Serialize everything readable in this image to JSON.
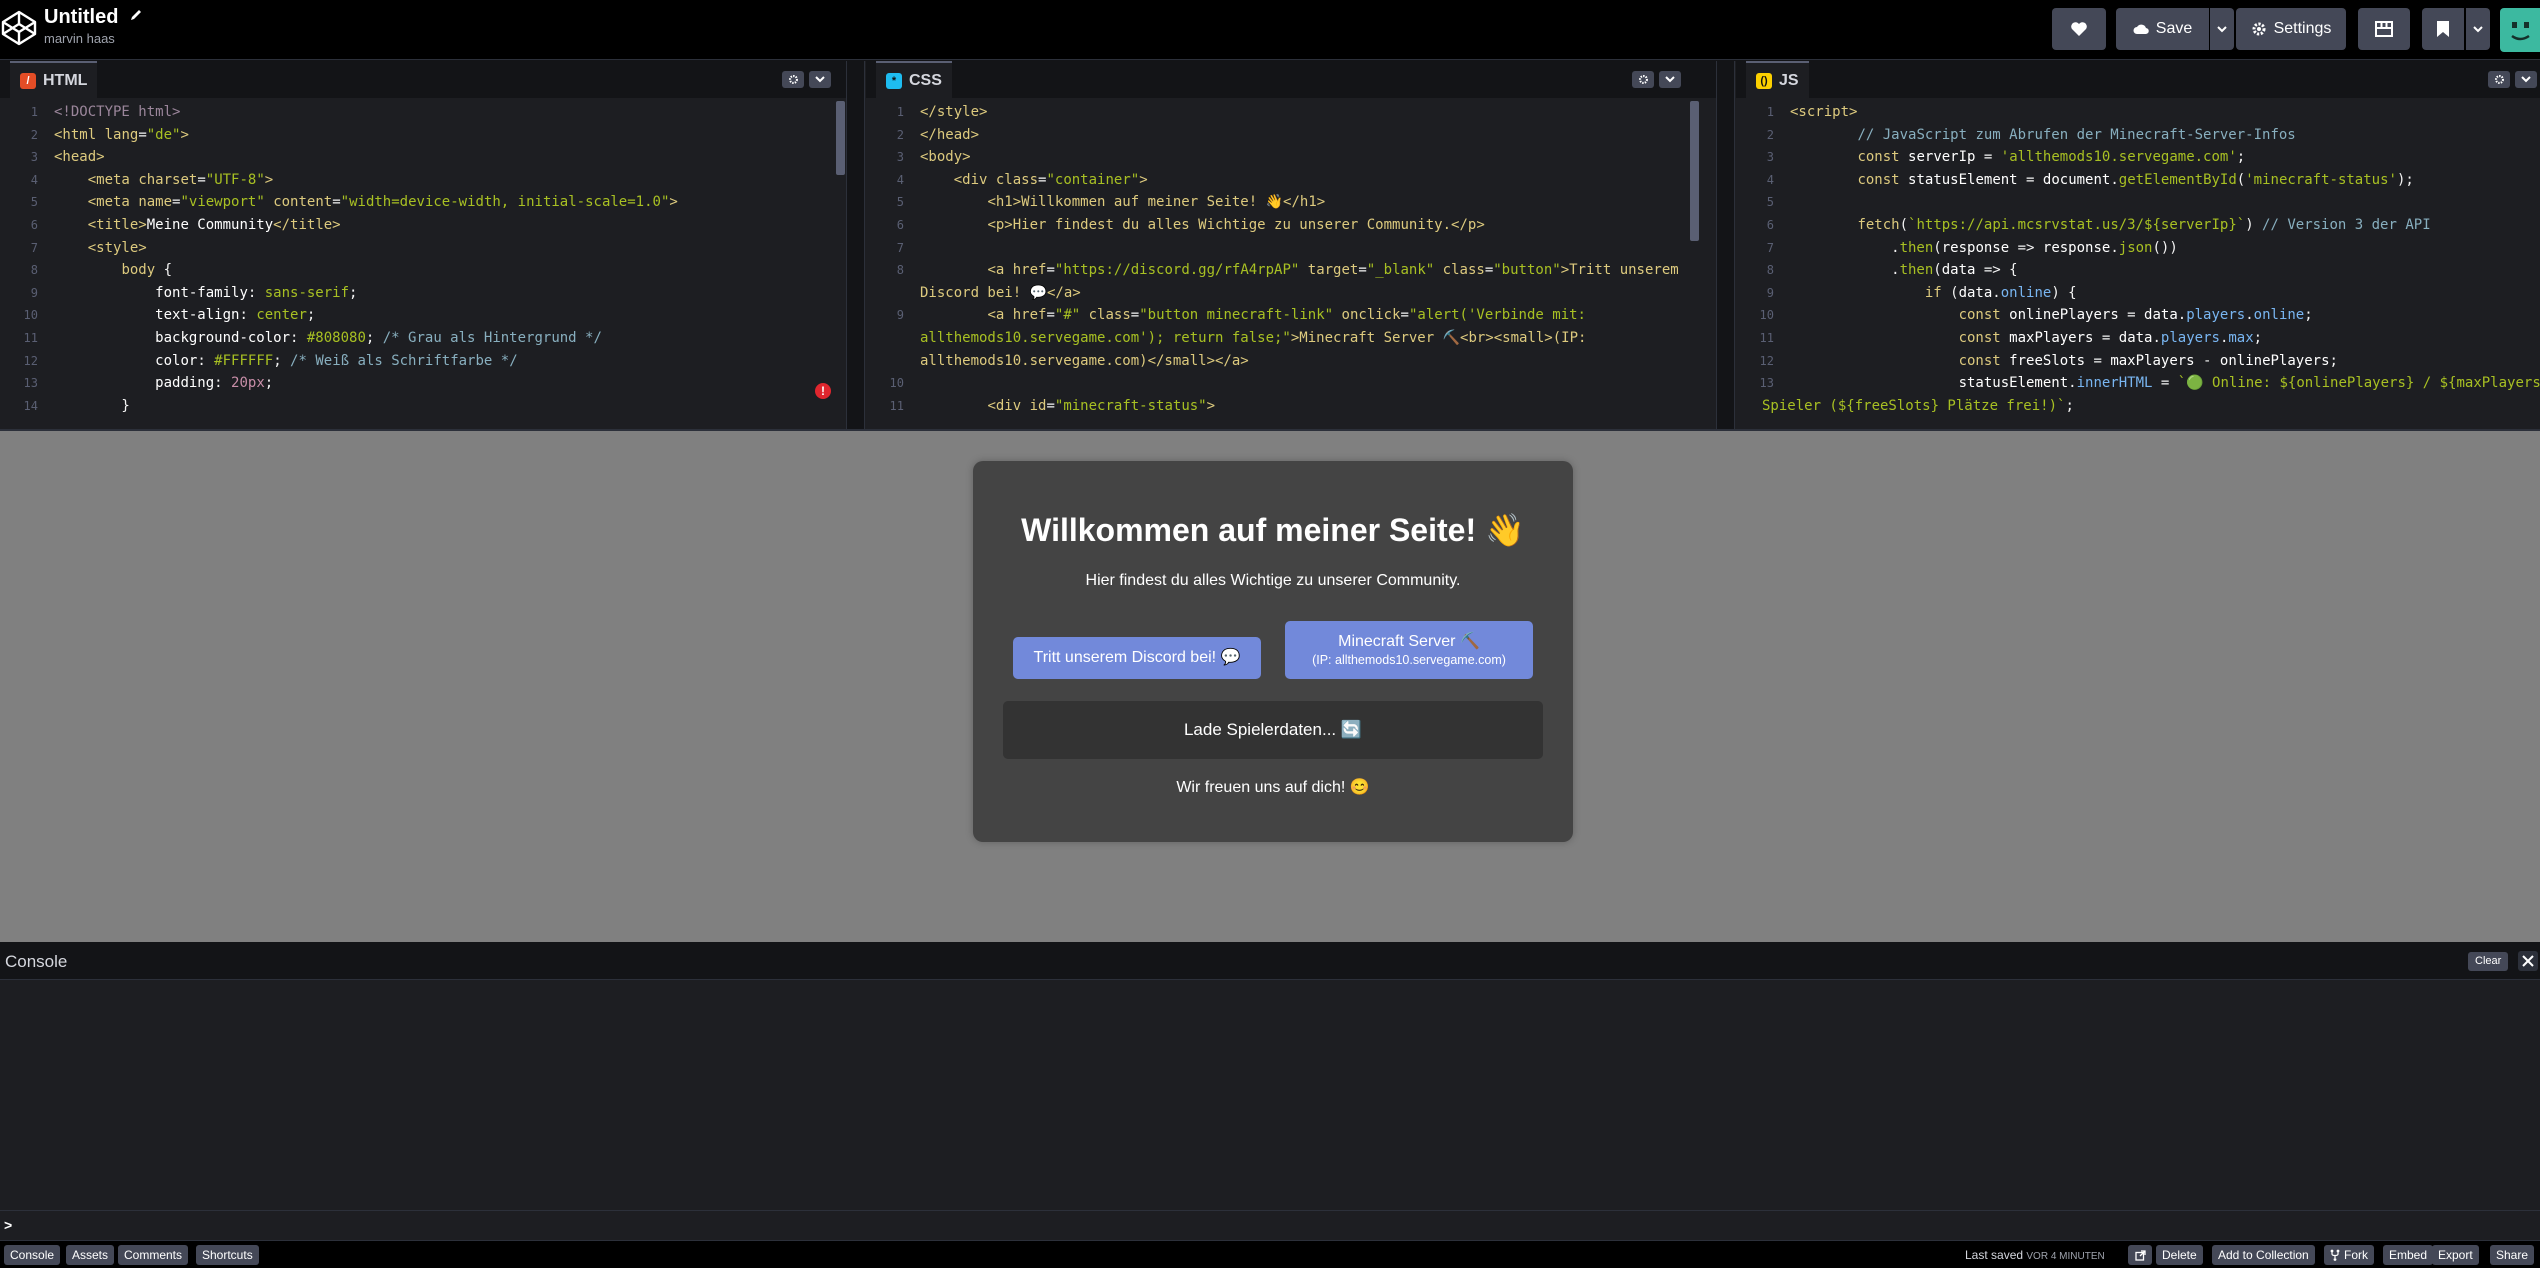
{
  "header": {
    "title": "Untitled",
    "author": "marvin haas",
    "buttons": {
      "heart_icon": "heart-icon",
      "save": "Save",
      "settings": "Settings"
    }
  },
  "editors": {
    "html": {
      "label": "HTML",
      "icon_color": "#e44d26",
      "lines": [
        "<!DOCTYPE html>",
        "<html lang=\"de\">",
        "<head>",
        "    <meta charset=\"UTF-8\">",
        "    <meta name=\"viewport\" content=\"width=device-width, initial-scale=1.0\">",
        "    <title>Meine Community</title>",
        "    <style>",
        "        body {",
        "            font-family: sans-serif;",
        "            text-align: center;",
        "            background-color: #808080; /* Grau als Hintergrund */",
        "            color: #FFFFFF; /* Weiß als Schriftfarbe */",
        "            padding: 20px;",
        "        }"
      ]
    },
    "css": {
      "label": "CSS",
      "icon_color": "#1ebcf0",
      "lines": [
        "</style>",
        "</head>",
        "<body>",
        "    <div class=\"container\">",
        "        <h1>Willkommen auf meiner Seite! 👋</h1>",
        "        <p>Hier findest du alles Wichtige zu unserer Community.</p>",
        "",
        "        <a href=\"https://discord.gg/rfA4rpAP\" target=\"_blank\" class=\"button\">Tritt unserem",
        "Discord bei! 💬</a>",
        "        <a href=\"#\" class=\"button minecraft-link\" onclick=\"alert('Verbinde mit:",
        "allthemods10.servegame.com'); return false;\">Minecraft Server ⛏️<br><small>(IP:",
        "allthemods10.servegame.com)</small></a>",
        "",
        "        <div id=\"minecraft-status\">"
      ],
      "line_numbers": [
        "1",
        "2",
        "3",
        "4",
        "5",
        "6",
        "7",
        "8",
        "",
        "9",
        "",
        "",
        "10",
        "11"
      ]
    },
    "js": {
      "label": "JS",
      "icon_color": "#fcd000",
      "lines": [
        "<script>",
        "        // JavaScript zum Abrufen der Minecraft-Server-Infos",
        "        const serverIp = 'allthemods10.servegame.com';",
        "        const statusElement = document.getElementById('minecraft-status');",
        "",
        "        fetch(`https://api.mcsrvstat.us/3/${serverIp}`) // Version 3 der API",
        "            .then(response => response.json())",
        "            .then(data => {",
        "                if (data.online) {",
        "                    const onlinePlayers = data.players.online;",
        "                    const maxPlayers = data.players.max;",
        "                    const freeSlots = maxPlayers - onlinePlayers;",
        "                    statusElement.innerHTML = `🟢 Online: ${onlinePlayers} / ${maxPlayers}",
        "Spieler (${freeSlots} Plätze frei!)`;"
      ],
      "line_numbers": [
        "1",
        "2",
        "3",
        "4",
        "5",
        "6",
        "7",
        "8",
        "9",
        "10",
        "11",
        "12",
        "13",
        ""
      ]
    }
  },
  "preview": {
    "heading": "Willkommen auf meiner Seite! 👋",
    "subtitle": "Hier findest du alles Wichtige zu unserer Community.",
    "discord_button": "Tritt unserem Discord bei! 💬",
    "minecraft_button": "Minecraft Server ⛏️",
    "minecraft_ip": "(IP: allthemods10.servegame.com)",
    "status": "Lade Spielerdaten... 🔄",
    "footer": "Wir freuen uns auf dich! 😊",
    "colors": {
      "background": "#808080",
      "card": "#444444",
      "button": "#7289da",
      "status_box": "#333333"
    }
  },
  "console": {
    "title": "Console",
    "clear": "Clear",
    "prompt": ">"
  },
  "footer": {
    "tabs": [
      "Console",
      "Assets",
      "Comments",
      "Shortcuts"
    ],
    "saved_label": "Last saved",
    "saved_time": "VOR 4 MINUTEN",
    "actions": [
      "Delete",
      "Add to Collection",
      "Fork",
      "Embed",
      "Export",
      "Share"
    ]
  }
}
